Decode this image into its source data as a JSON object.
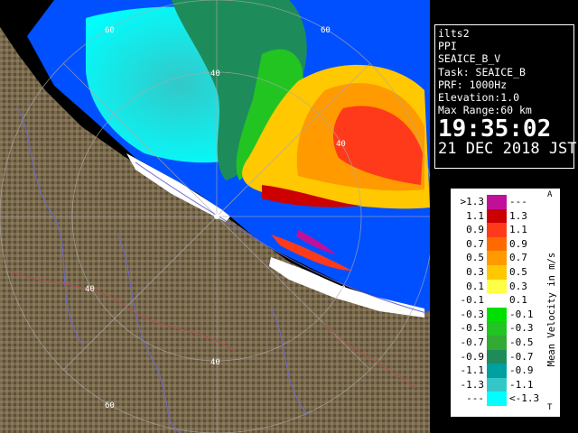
{
  "info": {
    "site": "ilts2",
    "product": "PPI",
    "scan_name": "SEAICE_B_V",
    "task": "Task: SEAICE_B",
    "prf": "PRF: 1000Hz",
    "elevation": "Elevation:1.0",
    "max_range": "Max Range:60 km",
    "time": "19:35:02",
    "date": "21 DEC 2018 JST"
  },
  "range_labels": {
    "north_60": "60",
    "north_40": "40",
    "ne_60": "60",
    "ne_40": "40",
    "west_40": "40",
    "south_40": "40",
    "south_60": "60",
    "east_40": "40"
  },
  "legend": {
    "title": "Mean Velocity in m/s",
    "top_marker": "A",
    "bottom_marker": "T",
    "rows": [
      {
        "lo": ">1.3",
        "hi": "---",
        "color": "#c0109a"
      },
      {
        "lo": "1.1",
        "hi": "1.3",
        "color": "#cc0000"
      },
      {
        "lo": "0.9",
        "hi": "1.1",
        "color": "#ff3a1a"
      },
      {
        "lo": "0.7",
        "hi": "0.9",
        "color": "#ff6a00"
      },
      {
        "lo": "0.5",
        "hi": "0.7",
        "color": "#ff9a00"
      },
      {
        "lo": "0.3",
        "hi": "0.5",
        "color": "#ffc800"
      },
      {
        "lo": "0.1",
        "hi": "0.3",
        "color": "#ffff44"
      },
      {
        "lo": "-0.1",
        "hi": "0.1",
        "color": "#ffffff"
      },
      {
        "lo": "-0.3",
        "hi": "-0.1",
        "color": "#00e000"
      },
      {
        "lo": "-0.5",
        "hi": "-0.3",
        "color": "#22c422"
      },
      {
        "lo": "-0.7",
        "hi": "-0.5",
        "color": "#33aa33"
      },
      {
        "lo": "-0.9",
        "hi": "-0.7",
        "color": "#1e8c5a"
      },
      {
        "lo": "-1.1",
        "hi": "-0.9",
        "color": "#00a0a0"
      },
      {
        "lo": "-1.3",
        "hi": "-1.1",
        "color": "#33c8c8"
      },
      {
        "lo": "---",
        "hi": "<-1.3",
        "color": "#00ffff"
      }
    ]
  },
  "colors": {
    "land": "#7a6a4e",
    "sea_echo": "#0050ff",
    "background": "#000000"
  }
}
